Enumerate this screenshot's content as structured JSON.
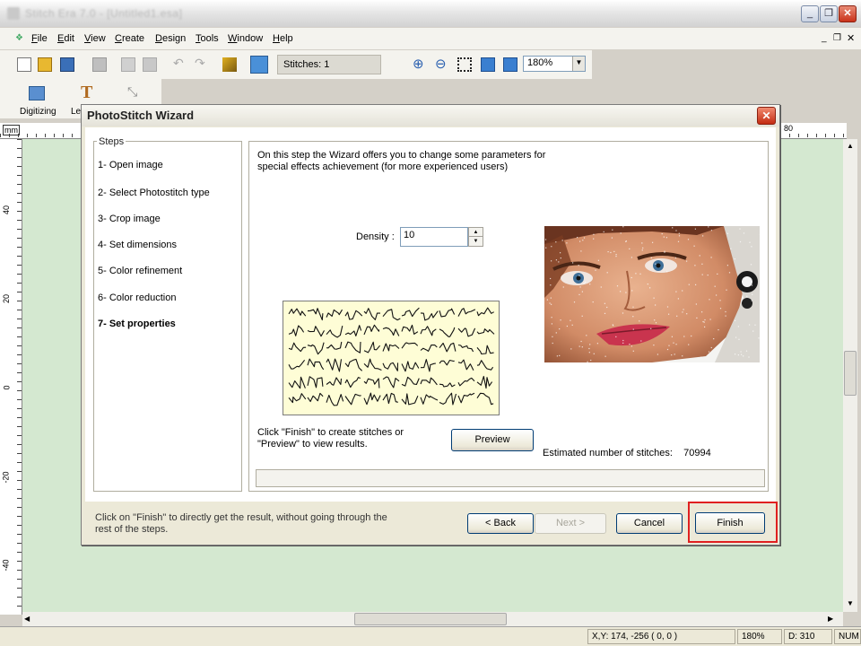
{
  "app": {
    "title": "Stitch Era 7.0 - [Untitled1.esa]"
  },
  "menu": [
    "File",
    "Edit",
    "View",
    "Create",
    "Design",
    "Tools",
    "Window",
    "Help"
  ],
  "toolbar": {
    "stitches_label": "Stitches: 1",
    "zoom_value": "180%"
  },
  "ribbon": {
    "digitizing_label": "Digitizing",
    "lettering_label": "Le"
  },
  "ruler": {
    "unit": "mm",
    "top_tick": "80",
    "left_ticks": [
      "40",
      "20",
      "0",
      "-20",
      "-40"
    ]
  },
  "dialog": {
    "title": "PhotoStitch Wizard",
    "steps_header": "Steps",
    "steps": [
      "1- Open image",
      "2- Select Photostitch type",
      "3- Crop image",
      "4- Set dimensions",
      "5- Color refinement",
      "6-  Color reduction",
      "7-  Set properties"
    ],
    "current_step_index": 6,
    "intro_text": "On this step the Wizard offers you to change some parameters for special effects achievement (for more experienced users)",
    "density_label": "Density :",
    "density_value": "10",
    "click_finish_text": "Click \"Finish\" to create stitches or \"Preview\" to view results.",
    "preview_label": "Preview",
    "estimated_label": "Estimated number of stitches:",
    "estimated_value": "70994",
    "hint_text": "Click on \"Finish\" to directly get the result, without going through the rest of the steps.",
    "back_label": "< Back",
    "next_label": "Next >",
    "cancel_label": "Cancel",
    "finish_label": "Finish"
  },
  "statusbar": {
    "coords": "X,Y: 174, -256  ( 0, 0 )",
    "zoom": "180%",
    "d": "D: 310",
    "num": "NUM"
  }
}
